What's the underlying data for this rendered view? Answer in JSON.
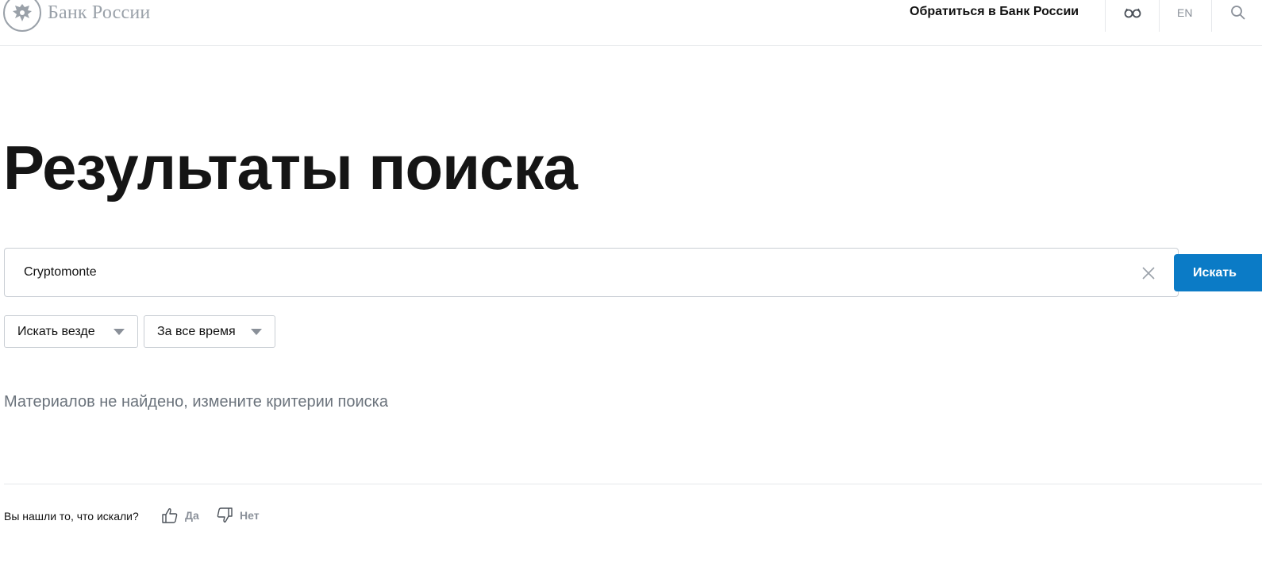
{
  "header": {
    "logo_text": "Банк России",
    "appeal_link": "Обратиться в Банк России",
    "lang_switch": "EN",
    "icons": {
      "emblem": "double-headed-eagle-emblem",
      "accessibility": "glasses-icon",
      "search": "search-icon"
    }
  },
  "main": {
    "title": "Результаты поиска",
    "search": {
      "value": "Cryptomonte",
      "submit_label": "Искать",
      "clear_icon": "close-icon"
    },
    "filters": [
      {
        "label": "Искать везде",
        "icon": "caret-down-icon"
      },
      {
        "label": "За все время",
        "icon": "caret-down-icon"
      }
    ],
    "empty_message": "Материалов не найдено, измените критерии поиска"
  },
  "feedback": {
    "question": "Вы нашли то, что искали?",
    "yes_label": "Да",
    "no_label": "Нет",
    "yes_icon": "thumbs-up-icon",
    "no_icon": "thumbs-down-icon"
  },
  "colors": {
    "accent": "#0b7bc6",
    "muted_text": "#6b737c",
    "border": "#c9ced4"
  }
}
